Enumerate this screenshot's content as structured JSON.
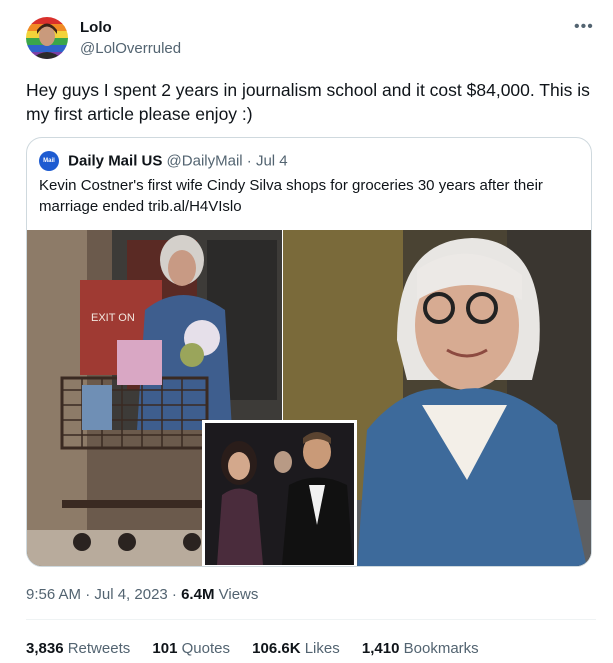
{
  "author": {
    "display_name": "Lolo",
    "handle": "@LolOverruled",
    "avatar_icon": "avatar-photo"
  },
  "more_icon": "ellipsis-icon",
  "tweet_text": "Hey guys I spent 2 years in journalism school and it cost $84,000. This is my first article please enjoy :)",
  "quoted": {
    "logo_text": "Mail",
    "author_name": "Daily Mail US",
    "handle": "@DailyMail",
    "separator": "·",
    "date": "Jul 4",
    "text": "Kevin Costner's first wife Cindy Silva shops for groceries 30 years after their marriage ended trib.al/H4VIslo",
    "photo_sign_text": "EXIT ON"
  },
  "timestamp": {
    "time_date": "9:56 AM · Jul 4, 2023 · ",
    "views_count": "6.4M",
    "views_label": "Views"
  },
  "stats": [
    {
      "count": "3,836",
      "label": "Retweets"
    },
    {
      "count": "101",
      "label": "Quotes"
    },
    {
      "count": "106.6K",
      "label": "Likes"
    },
    {
      "count": "1,410",
      "label": "Bookmarks"
    }
  ],
  "colors": {
    "secondary_text": "#536471",
    "border": "#cfd9de",
    "daily_mail_logo": "#1d5bd1"
  }
}
